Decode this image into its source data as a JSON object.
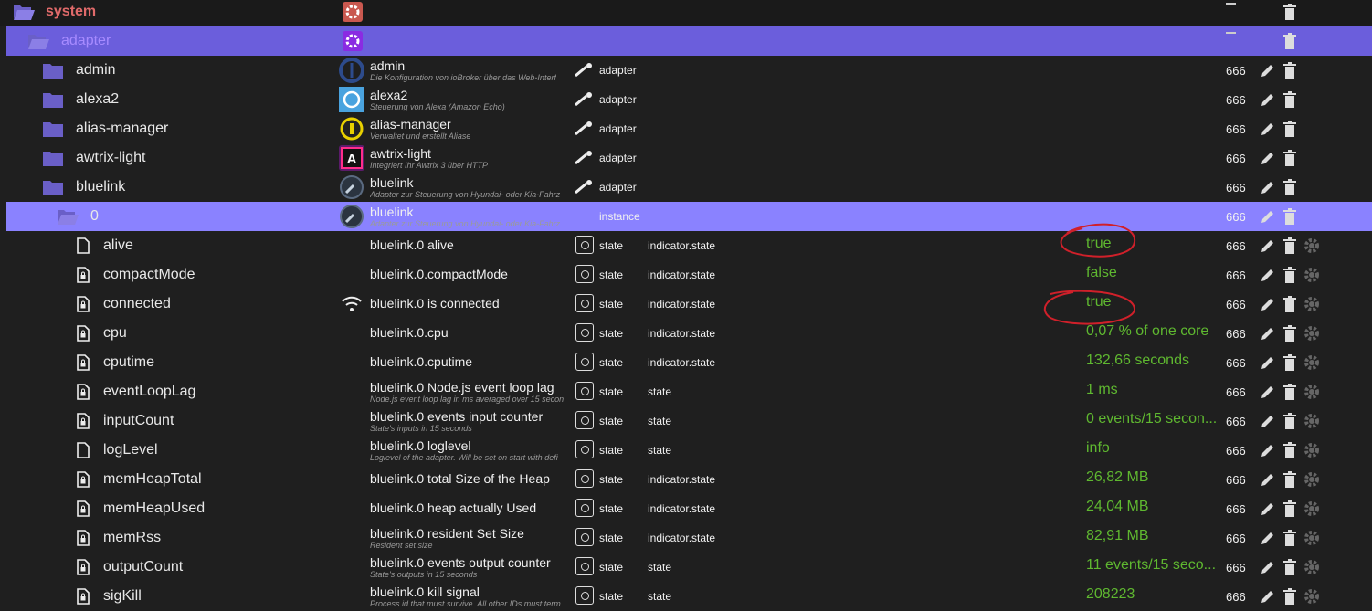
{
  "rows": [
    {
      "kind": "root",
      "name": "system",
      "acl": "",
      "val": ""
    },
    {
      "kind": "folder-sel",
      "name": "adapter"
    },
    {
      "kind": "adapter",
      "name": "admin",
      "title": "admin",
      "desc": "Die Konfiguration von ioBroker über das Web-Interf",
      "type": "adapter",
      "acl": "666",
      "icon": "admin-logo-icon"
    },
    {
      "kind": "adapter",
      "name": "alexa2",
      "title": "alexa2",
      "desc": "Steuerung von Alexa (Amazon Echo)",
      "type": "adapter",
      "acl": "666",
      "icon": "alexa-logo-icon"
    },
    {
      "kind": "adapter",
      "name": "alias-manager",
      "title": "alias-manager",
      "desc": "Verwaltet und erstellt Aliase",
      "type": "adapter",
      "acl": "666",
      "icon": "alias-manager-logo-icon"
    },
    {
      "kind": "adapter",
      "name": "awtrix-light",
      "title": "awtrix-light",
      "desc": "Integriert Ihr Awtrix 3 über HTTP",
      "type": "adapter",
      "acl": "666",
      "icon": "awtrix-logo-icon"
    },
    {
      "kind": "adapter",
      "name": "bluelink",
      "title": "bluelink",
      "desc": "Adapter zur Steuerung von Hyundai- oder Kia-Fahrz",
      "type": "adapter",
      "acl": "666",
      "icon": "bluelink-logo-icon"
    },
    {
      "kind": "instance",
      "name": "0",
      "title": "bluelink",
      "desc": "Adapter zur Steuerung von Hyundai- oder Kia-Fahrz",
      "type": "instance",
      "acl": "666"
    },
    {
      "kind": "state",
      "name": "alive",
      "title": "bluelink.0 alive",
      "desc": "",
      "type": "state",
      "role": "indicator.state",
      "val": "true",
      "acl": "666",
      "plain": true
    },
    {
      "kind": "state",
      "name": "compactMode",
      "title": "bluelink.0.compactMode",
      "desc": "",
      "type": "state",
      "role": "indicator.state",
      "val": "false",
      "acl": "666"
    },
    {
      "kind": "state",
      "name": "connected",
      "title": "bluelink.0 is connected",
      "desc": "",
      "type": "state",
      "role": "indicator.state",
      "val": "true",
      "acl": "666",
      "wifi": true
    },
    {
      "kind": "state",
      "name": "cpu",
      "title": "bluelink.0.cpu",
      "desc": "",
      "type": "state",
      "role": "indicator.state",
      "val": "0,07 % of one core",
      "acl": "666"
    },
    {
      "kind": "state",
      "name": "cputime",
      "title": "bluelink.0.cputime",
      "desc": "",
      "type": "state",
      "role": "indicator.state",
      "val": "132,66 seconds",
      "acl": "666"
    },
    {
      "kind": "state",
      "name": "eventLoopLag",
      "title": "bluelink.0 Node.js event loop lag",
      "desc": "Node.js event loop lag in ms averaged over 15 secon",
      "type": "state",
      "role": "state",
      "val": "1 ms",
      "acl": "666"
    },
    {
      "kind": "state",
      "name": "inputCount",
      "title": "bluelink.0 events input counter",
      "desc": "State's inputs in 15 seconds",
      "type": "state",
      "role": "state",
      "val": "0 events/15 secon...",
      "acl": "666"
    },
    {
      "kind": "state",
      "name": "logLevel",
      "title": "bluelink.0 loglevel",
      "desc": "Loglevel of the adapter. Will be set on start with defi",
      "type": "state",
      "role": "state",
      "val": "info",
      "acl": "666",
      "plain": true
    },
    {
      "kind": "state",
      "name": "memHeapTotal",
      "title": "bluelink.0 total Size of the Heap",
      "desc": "",
      "type": "state",
      "role": "indicator.state",
      "val": "26,82 MB",
      "acl": "666"
    },
    {
      "kind": "state",
      "name": "memHeapUsed",
      "title": "bluelink.0 heap actually Used",
      "desc": "",
      "type": "state",
      "role": "indicator.state",
      "val": "24,04 MB",
      "acl": "666"
    },
    {
      "kind": "state",
      "name": "memRss",
      "title": "bluelink.0 resident Set Size",
      "desc": "Resident set size",
      "type": "state",
      "role": "indicator.state",
      "val": "82,91 MB",
      "acl": "666"
    },
    {
      "kind": "state",
      "name": "outputCount",
      "title": "bluelink.0 events output counter",
      "desc": "State's outputs in 15 seconds",
      "type": "state",
      "role": "state",
      "val": "11 events/15 seco...",
      "acl": "666"
    },
    {
      "kind": "state",
      "name": "sigKill",
      "title": "bluelink.0 kill signal",
      "desc": "Process id that must survive. All other IDs must term",
      "type": "state",
      "role": "state",
      "val": "208223",
      "acl": "666"
    }
  ],
  "colors": {
    "selected": "#8a82ff",
    "selected_folder": "#6b5edc",
    "value": "#5fb830",
    "annotation": "#d0202a"
  }
}
